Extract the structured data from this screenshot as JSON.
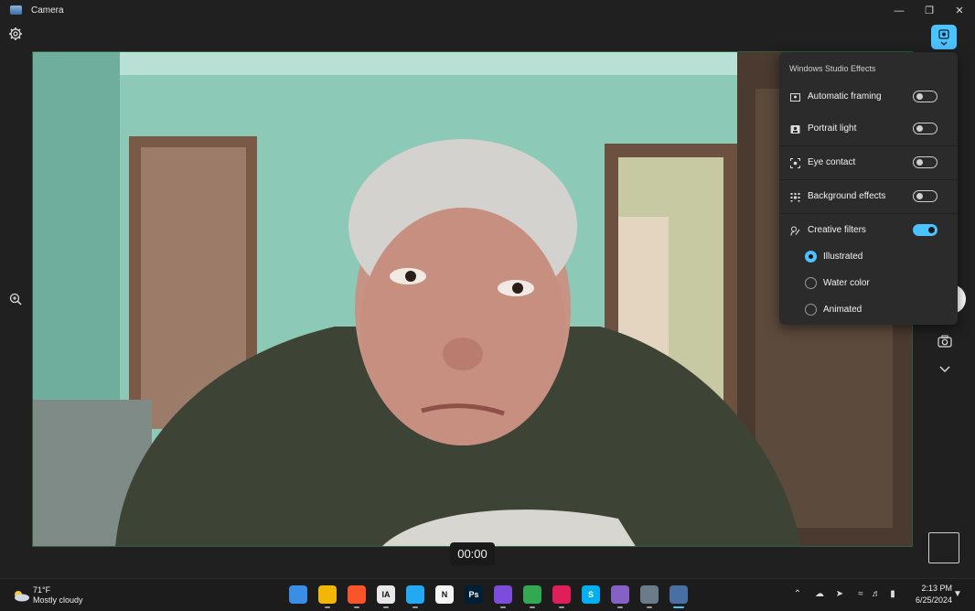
{
  "window": {
    "title": "Camera"
  },
  "viewfinder": {
    "recording_time": "00:00"
  },
  "effects_panel": {
    "title": "Windows Studio Effects",
    "toggles": [
      {
        "label": "Automatic framing",
        "icon": "auto-framing-icon",
        "on": false
      },
      {
        "label": "Portrait light",
        "icon": "portrait-light-icon",
        "on": false
      },
      {
        "label": "Eye contact",
        "icon": "eye-contact-icon",
        "on": false
      },
      {
        "label": "Background effects",
        "icon": "background-effects-icon",
        "on": false
      },
      {
        "label": "Creative filters",
        "icon": "creative-filters-icon",
        "on": true
      }
    ],
    "filters": [
      {
        "label": "Illustrated",
        "selected": true
      },
      {
        "label": "Water color",
        "selected": false
      },
      {
        "label": "Animated",
        "selected": false
      }
    ]
  },
  "taskbar": {
    "weather": {
      "temp": "71°F",
      "desc": "Mostly cloudy"
    },
    "apps": [
      {
        "label": "",
        "color": "#3a8ee6",
        "icon": "start-icon"
      },
      {
        "label": "",
        "color": "#f2b705",
        "icon": "file-explorer-icon"
      },
      {
        "label": "",
        "color": "#fb542b",
        "icon": "brave-icon"
      },
      {
        "label": "IA",
        "color": "#e8e8e8",
        "icon": "ia-writer-icon"
      },
      {
        "label": "",
        "color": "#23a9f2",
        "icon": "vscode-icon"
      },
      {
        "label": "N",
        "color": "#f5f5f5",
        "icon": "notion-icon"
      },
      {
        "label": "Ps",
        "color": "#001e36",
        "icon": "photoshop-icon"
      },
      {
        "label": "",
        "color": "#7d4cdb",
        "icon": "affinity-icon"
      },
      {
        "label": "",
        "color": "#33a852",
        "icon": "globe-app-icon"
      },
      {
        "label": "",
        "color": "#e01e5a",
        "icon": "slack-icon"
      },
      {
        "label": "S",
        "color": "#00aff0",
        "icon": "skype-icon"
      },
      {
        "label": "",
        "color": "#8661c5",
        "icon": "visual-studio-icon"
      },
      {
        "label": "",
        "color": "#6b7b8c",
        "icon": "settings-app-icon"
      },
      {
        "label": "",
        "color": "#4a6fa5",
        "icon": "camera-app-icon"
      }
    ],
    "clock": {
      "time": "2:13 PM",
      "date": "6/25/2024"
    }
  }
}
